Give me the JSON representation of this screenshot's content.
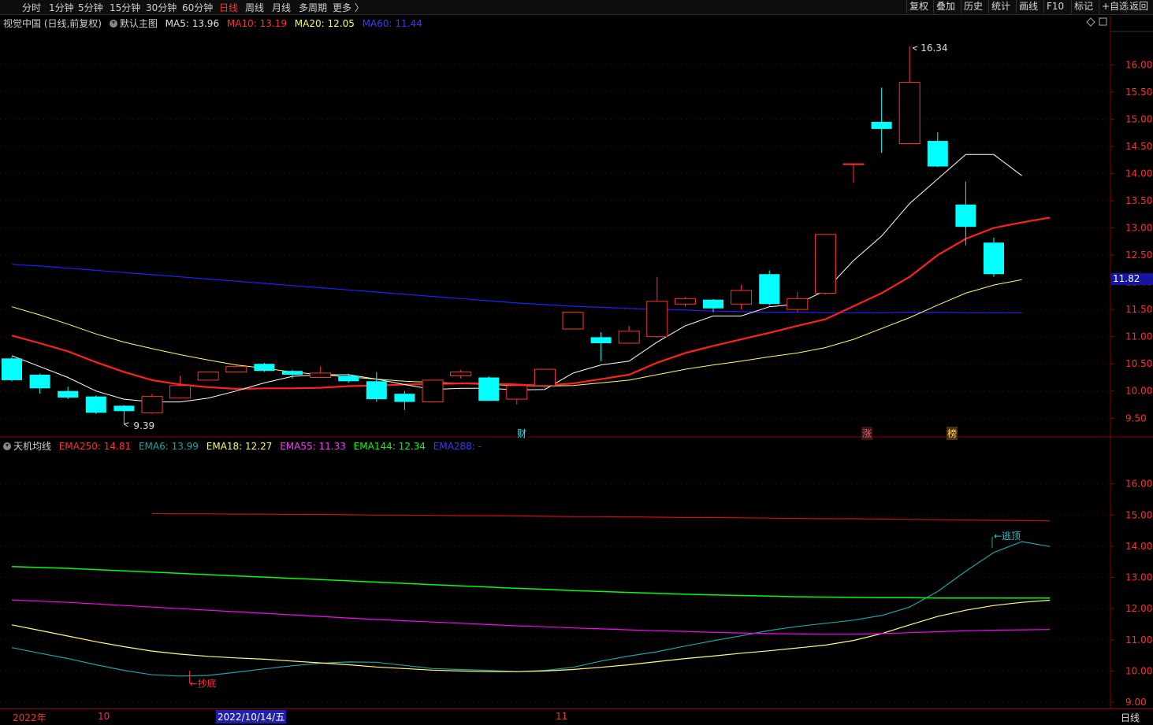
{
  "toolbar": {
    "tabs": [
      "分时",
      "1分钟",
      "5分钟",
      "15分钟",
      "30分钟",
      "60分钟",
      "日线",
      "周线",
      "月线",
      "多周期",
      "更多 〉"
    ],
    "active_tab": "日线",
    "right_buttons": [
      "复权",
      "叠加",
      "历史",
      "统计",
      "画线",
      "F10",
      "标记",
      "+自选",
      "返回"
    ]
  },
  "main_legend": {
    "stock": "视觉中国 (日线,前复权)",
    "indicator": "默认主图",
    "ma5": "MA5: 13.96",
    "ma10": "MA10: 13.19",
    "ma20": "MA20: 12.05",
    "ma60": "MA60: 11.44"
  },
  "sub_legend": {
    "name": "天机均线",
    "ema250": "EMA250: 14.81",
    "ema6": "EMA6: 13.99",
    "ema18": "EMA18: 12.27",
    "ema55": "EMA55: 11.33",
    "ema144": "EMA144: 12.34",
    "ema288": "EMA288: -"
  },
  "price_tag": "11.82",
  "annotations": {
    "high": "16.34",
    "low": "9.39",
    "top_signal": "逃顶",
    "bottom_signal": "抄底",
    "marker_cai": "财",
    "marker_zhang": "涨",
    "marker_bang": "榜"
  },
  "bottom_axis": {
    "year": "2022年",
    "m10": "10",
    "cursor_date": "2022/10/14/五",
    "m11": "11",
    "period": "日线"
  },
  "colors": {
    "up": "#ff3232",
    "down": "#00ffff",
    "ma5": "#ffffff",
    "ma10": "#ff2020",
    "ma20": "#ffff66",
    "ma60": "#2020ff",
    "ema6": "#1aa5a5",
    "ema144": "#00ff00",
    "ema55": "#ff00ff",
    "ema250": "#cc1010"
  },
  "chart_data": [
    {
      "type": "candlestick",
      "title": "视觉中国 (日线,前复权)",
      "ylim": [
        9.2,
        16.7
      ],
      "yticks": [
        9.5,
        10.0,
        10.5,
        11.0,
        11.5,
        12.0,
        12.5,
        13.0,
        13.5,
        14.0,
        14.5,
        15.0,
        15.5,
        16.0
      ],
      "candles": [
        {
          "o": 10.6,
          "h": 10.63,
          "l": 10.18,
          "c": 10.2
        },
        {
          "o": 10.3,
          "h": 10.32,
          "l": 9.95,
          "c": 10.05
        },
        {
          "o": 10.0,
          "h": 10.08,
          "l": 9.85,
          "c": 9.88
        },
        {
          "o": 9.9,
          "h": 9.92,
          "l": 9.58,
          "c": 9.6
        },
        {
          "o": 9.73,
          "h": 9.74,
          "l": 9.39,
          "c": 9.63
        },
        {
          "o": 9.6,
          "h": 9.95,
          "l": 9.58,
          "c": 9.9
        },
        {
          "o": 9.87,
          "h": 10.28,
          "l": 9.86,
          "c": 10.1
        },
        {
          "o": 10.2,
          "h": 10.36,
          "l": 10.19,
          "c": 10.35
        },
        {
          "o": 10.35,
          "h": 10.47,
          "l": 10.34,
          "c": 10.45
        },
        {
          "o": 10.5,
          "h": 10.52,
          "l": 10.35,
          "c": 10.37
        },
        {
          "o": 10.37,
          "h": 10.39,
          "l": 10.23,
          "c": 10.3
        },
        {
          "o": 10.25,
          "h": 10.45,
          "l": 10.24,
          "c": 10.33
        },
        {
          "o": 10.28,
          "h": 10.32,
          "l": 10.15,
          "c": 10.18
        },
        {
          "o": 10.18,
          "h": 10.35,
          "l": 9.8,
          "c": 9.85
        },
        {
          "o": 9.95,
          "h": 10.0,
          "l": 9.65,
          "c": 9.8
        },
        {
          "o": 9.8,
          "h": 10.2,
          "l": 9.79,
          "c": 10.2
        },
        {
          "o": 10.28,
          "h": 10.39,
          "l": 10.23,
          "c": 10.35
        },
        {
          "o": 10.25,
          "h": 10.27,
          "l": 9.82,
          "c": 9.82
        },
        {
          "o": 9.85,
          "h": 10.12,
          "l": 9.75,
          "c": 10.1
        },
        {
          "o": 10.1,
          "h": 10.4,
          "l": 10.05,
          "c": 10.4
        },
        {
          "o": 11.14,
          "h": 11.15,
          "l": 11.13,
          "c": 11.45
        },
        {
          "o": 10.99,
          "h": 11.08,
          "l": 10.55,
          "c": 10.88
        },
        {
          "o": 10.88,
          "h": 11.2,
          "l": 10.87,
          "c": 11.1
        },
        {
          "o": 11.0,
          "h": 12.1,
          "l": 10.98,
          "c": 11.65
        },
        {
          "o": 11.6,
          "h": 11.73,
          "l": 11.55,
          "c": 11.7
        },
        {
          "o": 11.68,
          "h": 11.69,
          "l": 11.45,
          "c": 11.52
        },
        {
          "o": 11.6,
          "h": 11.95,
          "l": 11.5,
          "c": 11.85
        },
        {
          "o": 12.15,
          "h": 12.22,
          "l": 11.57,
          "c": 11.6
        },
        {
          "o": 11.5,
          "h": 11.82,
          "l": 11.45,
          "c": 11.7
        },
        {
          "o": 11.8,
          "h": 12.88,
          "l": 11.78,
          "c": 12.88
        },
        {
          "o": 14.18,
          "h": 14.19,
          "l": 13.83,
          "c": 14.18
        },
        {
          "o": 14.95,
          "h": 15.58,
          "l": 14.38,
          "c": 14.82
        },
        {
          "o": 14.55,
          "h": 16.34,
          "l": 14.54,
          "c": 15.68
        },
        {
          "o": 14.6,
          "h": 14.76,
          "l": 14.12,
          "c": 14.13
        },
        {
          "o": 13.43,
          "h": 13.85,
          "l": 12.68,
          "c": 13.02
        },
        {
          "o": 12.73,
          "h": 12.82,
          "l": 12.1,
          "c": 12.15
        }
      ],
      "ma5": [
        10.65,
        10.45,
        10.25,
        10.0,
        9.85,
        9.8,
        9.8,
        9.87,
        10.0,
        10.15,
        10.27,
        10.3,
        10.3,
        10.22,
        10.12,
        10.03,
        10.05,
        10.05,
        10.02,
        10.03,
        10.33,
        10.48,
        10.55,
        10.9,
        11.2,
        11.38,
        11.38,
        11.55,
        11.6,
        11.85,
        12.4,
        12.85,
        13.45,
        13.9,
        14.35,
        14.35,
        13.96
      ],
      "ma10": [
        11.02,
        10.88,
        10.73,
        10.53,
        10.35,
        10.2,
        10.12,
        10.07,
        10.04,
        10.05,
        10.05,
        10.06,
        10.09,
        10.1,
        10.12,
        10.13,
        10.14,
        10.14,
        10.12,
        10.1,
        10.14,
        10.22,
        10.3,
        10.52,
        10.7,
        10.83,
        10.95,
        11.07,
        11.2,
        11.32,
        11.56,
        11.8,
        12.1,
        12.5,
        12.8,
        13.0,
        13.1,
        13.19
      ],
      "ma20": [
        11.55,
        11.4,
        11.23,
        11.05,
        10.9,
        10.78,
        10.67,
        10.57,
        10.48,
        10.42,
        10.35,
        10.3,
        10.26,
        10.22,
        10.18,
        10.16,
        10.14,
        10.12,
        10.1,
        10.09,
        10.1,
        10.15,
        10.2,
        10.3,
        10.4,
        10.48,
        10.55,
        10.63,
        10.7,
        10.8,
        10.95,
        11.15,
        11.35,
        11.58,
        11.8,
        11.95,
        12.05
      ],
      "ma60": [
        12.33,
        12.3,
        12.26,
        12.22,
        12.18,
        12.14,
        12.1,
        12.06,
        12.02,
        11.98,
        11.94,
        11.9,
        11.86,
        11.82,
        11.78,
        11.74,
        11.7,
        11.66,
        11.62,
        11.59,
        11.56,
        11.54,
        11.52,
        11.5,
        11.49,
        11.47,
        11.46,
        11.45,
        11.45,
        11.44,
        11.44,
        11.44,
        11.45,
        11.45,
        11.44,
        11.44,
        11.44
      ]
    },
    {
      "type": "line",
      "title": "天机均线",
      "ylim": [
        8.8,
        17.0
      ],
      "yticks": [
        9.0,
        10.0,
        11.0,
        12.0,
        13.0,
        14.0,
        15.0,
        16.0
      ],
      "series": [
        {
          "name": "EMA250",
          "start": 5,
          "values": [
            15.05,
            15.04,
            15.04,
            15.03,
            15.03,
            15.02,
            15.02,
            15.01,
            15.0,
            15.0,
            14.99,
            14.98,
            14.98,
            14.97,
            14.96,
            14.95,
            14.95,
            14.94,
            14.93,
            14.92,
            14.92,
            14.91,
            14.9,
            14.89,
            14.88,
            14.88,
            14.87,
            14.86,
            14.85,
            14.84,
            14.83,
            14.82,
            14.81
          ]
        },
        {
          "name": "EMA6",
          "start": 0,
          "values": [
            10.75,
            10.57,
            10.4,
            10.2,
            10.02,
            9.88,
            9.84,
            9.86,
            9.96,
            10.07,
            10.17,
            10.25,
            10.29,
            10.28,
            10.18,
            10.08,
            10.05,
            10.02,
            9.98,
            10.02,
            10.12,
            10.32,
            10.48,
            10.62,
            10.8,
            10.97,
            11.13,
            11.3,
            11.43,
            11.53,
            11.63,
            11.78,
            12.05,
            12.55,
            13.2,
            13.8,
            14.15,
            13.99
          ]
        },
        {
          "name": "EMA18",
          "start": 0,
          "values": [
            11.48,
            11.3,
            11.12,
            10.94,
            10.78,
            10.64,
            10.54,
            10.47,
            10.42,
            10.38,
            10.32,
            10.26,
            10.2,
            10.13,
            10.08,
            10.03,
            10.0,
            9.98,
            9.98,
            10.0,
            10.05,
            10.12,
            10.2,
            10.3,
            10.4,
            10.48,
            10.57,
            10.65,
            10.74,
            10.83,
            10.98,
            11.2,
            11.48,
            11.75,
            11.95,
            12.1,
            12.2,
            12.27
          ]
        },
        {
          "name": "EMA55",
          "start": 0,
          "values": [
            12.28,
            12.24,
            12.2,
            12.15,
            12.1,
            12.05,
            12.0,
            11.95,
            11.9,
            11.85,
            11.8,
            11.75,
            11.7,
            11.65,
            11.61,
            11.57,
            11.53,
            11.49,
            11.45,
            11.42,
            11.38,
            11.35,
            11.32,
            11.29,
            11.27,
            11.24,
            11.22,
            11.2,
            11.19,
            11.18,
            11.18,
            11.2,
            11.23,
            11.26,
            11.29,
            11.31,
            11.32,
            11.33
          ]
        },
        {
          "name": "EMA144",
          "start": 0,
          "values": [
            13.35,
            13.32,
            13.29,
            13.25,
            13.21,
            13.17,
            13.13,
            13.09,
            13.05,
            13.01,
            12.97,
            12.93,
            12.89,
            12.85,
            12.81,
            12.77,
            12.73,
            12.69,
            12.65,
            12.62,
            12.58,
            12.55,
            12.52,
            12.49,
            12.46,
            12.44,
            12.42,
            12.4,
            12.38,
            12.37,
            12.36,
            12.35,
            12.35,
            12.34,
            12.34,
            12.34,
            12.34,
            12.34
          ]
        }
      ]
    }
  ]
}
